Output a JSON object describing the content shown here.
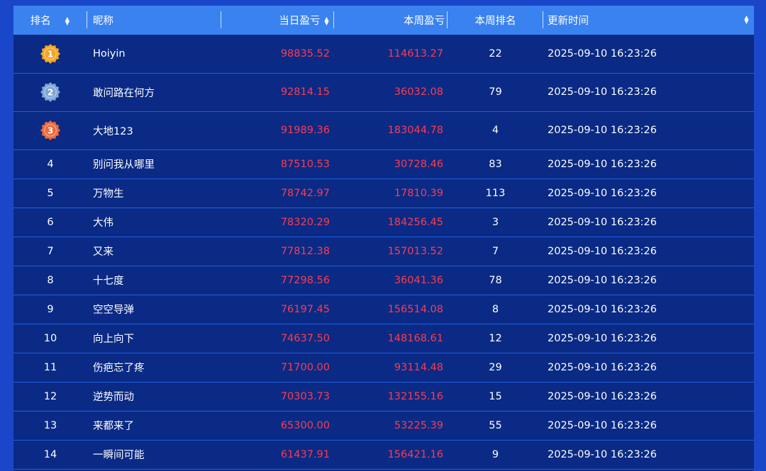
{
  "table": {
    "headers": {
      "rank": "排名",
      "name": "昵称",
      "daily_pl": "当日盈亏",
      "weekly_pl": "本周盈亏",
      "weekly_rank": "本周排名",
      "updated": "更新时间"
    },
    "sortable_icon": "sort-arrows-icon",
    "rows": [
      {
        "rank": "1",
        "medal": "gold-medal-icon",
        "name": "Hoiyin",
        "daily": "98835.52",
        "weekly": "114613.27",
        "weekly_rank": "22",
        "time": "2025-09-10 16:23:26"
      },
      {
        "rank": "2",
        "medal": "silver-medal-icon",
        "name": "敢问路在何方",
        "daily": "92814.15",
        "weekly": "36032.08",
        "weekly_rank": "79",
        "time": "2025-09-10 16:23:26"
      },
      {
        "rank": "3",
        "medal": "bronze-medal-icon",
        "name": "大地123",
        "daily": "91989.36",
        "weekly": "183044.78",
        "weekly_rank": "4",
        "time": "2025-09-10 16:23:26"
      },
      {
        "rank": "4",
        "name": "别问我从哪里",
        "daily": "87510.53",
        "weekly": "30728.46",
        "weekly_rank": "83",
        "time": "2025-09-10 16:23:26"
      },
      {
        "rank": "5",
        "name": "万物生",
        "daily": "78742.97",
        "weekly": "17810.39",
        "weekly_rank": "113",
        "time": "2025-09-10 16:23:26"
      },
      {
        "rank": "6",
        "name": "大伟",
        "daily": "78320.29",
        "weekly": "184256.45",
        "weekly_rank": "3",
        "time": "2025-09-10 16:23:26"
      },
      {
        "rank": "7",
        "name": "又来",
        "daily": "77812.38",
        "weekly": "157013.52",
        "weekly_rank": "7",
        "time": "2025-09-10 16:23:26"
      },
      {
        "rank": "8",
        "name": "十七度",
        "daily": "77298.56",
        "weekly": "36041.36",
        "weekly_rank": "78",
        "time": "2025-09-10 16:23:26"
      },
      {
        "rank": "9",
        "name": "空空导弹",
        "daily": "76197.45",
        "weekly": "156514.08",
        "weekly_rank": "8",
        "time": "2025-09-10 16:23:26"
      },
      {
        "rank": "10",
        "name": "向上向下",
        "daily": "74637.50",
        "weekly": "148168.61",
        "weekly_rank": "12",
        "time": "2025-09-10 16:23:26"
      },
      {
        "rank": "11",
        "name": "伤疤忘了疼",
        "daily": "71700.00",
        "weekly": "93114.48",
        "weekly_rank": "29",
        "time": "2025-09-10 16:23:26"
      },
      {
        "rank": "12",
        "name": "逆势而动",
        "daily": "70303.73",
        "weekly": "132155.16",
        "weekly_rank": "15",
        "time": "2025-09-10 16:23:26"
      },
      {
        "rank": "13",
        "name": "来都来了",
        "daily": "65300.00",
        "weekly": "53225.39",
        "weekly_rank": "55",
        "time": "2025-09-10 16:23:26"
      },
      {
        "rank": "14",
        "name": "一瞬间可能",
        "daily": "61437.91",
        "weekly": "156421.16",
        "weekly_rank": "9",
        "time": "2025-09-10 16:23:26"
      }
    ]
  },
  "colors": {
    "page_background": "#1a47c9",
    "header_background": "#3a82f0",
    "row_background": "#0a2a85",
    "row_divider": "#1f5fe0",
    "profit_text": "#ff3b4f",
    "text": "#ffffff",
    "gold": "#f5a623",
    "silver": "#7fa6d8",
    "bronze": "#f0693a"
  }
}
